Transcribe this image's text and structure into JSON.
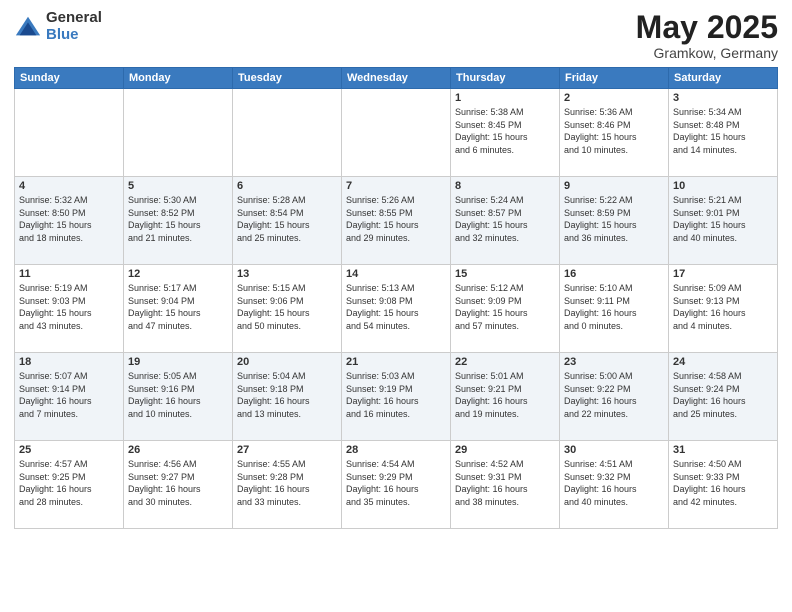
{
  "header": {
    "logo_general": "General",
    "logo_blue": "Blue",
    "month_year": "May 2025",
    "location": "Gramkow, Germany"
  },
  "weekdays": [
    "Sunday",
    "Monday",
    "Tuesday",
    "Wednesday",
    "Thursday",
    "Friday",
    "Saturday"
  ],
  "rows": [
    [
      {
        "day": "",
        "info": ""
      },
      {
        "day": "",
        "info": ""
      },
      {
        "day": "",
        "info": ""
      },
      {
        "day": "",
        "info": ""
      },
      {
        "day": "1",
        "info": "Sunrise: 5:38 AM\nSunset: 8:45 PM\nDaylight: 15 hours\nand 6 minutes."
      },
      {
        "day": "2",
        "info": "Sunrise: 5:36 AM\nSunset: 8:46 PM\nDaylight: 15 hours\nand 10 minutes."
      },
      {
        "day": "3",
        "info": "Sunrise: 5:34 AM\nSunset: 8:48 PM\nDaylight: 15 hours\nand 14 minutes."
      }
    ],
    [
      {
        "day": "4",
        "info": "Sunrise: 5:32 AM\nSunset: 8:50 PM\nDaylight: 15 hours\nand 18 minutes."
      },
      {
        "day": "5",
        "info": "Sunrise: 5:30 AM\nSunset: 8:52 PM\nDaylight: 15 hours\nand 21 minutes."
      },
      {
        "day": "6",
        "info": "Sunrise: 5:28 AM\nSunset: 8:54 PM\nDaylight: 15 hours\nand 25 minutes."
      },
      {
        "day": "7",
        "info": "Sunrise: 5:26 AM\nSunset: 8:55 PM\nDaylight: 15 hours\nand 29 minutes."
      },
      {
        "day": "8",
        "info": "Sunrise: 5:24 AM\nSunset: 8:57 PM\nDaylight: 15 hours\nand 32 minutes."
      },
      {
        "day": "9",
        "info": "Sunrise: 5:22 AM\nSunset: 8:59 PM\nDaylight: 15 hours\nand 36 minutes."
      },
      {
        "day": "10",
        "info": "Sunrise: 5:21 AM\nSunset: 9:01 PM\nDaylight: 15 hours\nand 40 minutes."
      }
    ],
    [
      {
        "day": "11",
        "info": "Sunrise: 5:19 AM\nSunset: 9:03 PM\nDaylight: 15 hours\nand 43 minutes."
      },
      {
        "day": "12",
        "info": "Sunrise: 5:17 AM\nSunset: 9:04 PM\nDaylight: 15 hours\nand 47 minutes."
      },
      {
        "day": "13",
        "info": "Sunrise: 5:15 AM\nSunset: 9:06 PM\nDaylight: 15 hours\nand 50 minutes."
      },
      {
        "day": "14",
        "info": "Sunrise: 5:13 AM\nSunset: 9:08 PM\nDaylight: 15 hours\nand 54 minutes."
      },
      {
        "day": "15",
        "info": "Sunrise: 5:12 AM\nSunset: 9:09 PM\nDaylight: 15 hours\nand 57 minutes."
      },
      {
        "day": "16",
        "info": "Sunrise: 5:10 AM\nSunset: 9:11 PM\nDaylight: 16 hours\nand 0 minutes."
      },
      {
        "day": "17",
        "info": "Sunrise: 5:09 AM\nSunset: 9:13 PM\nDaylight: 16 hours\nand 4 minutes."
      }
    ],
    [
      {
        "day": "18",
        "info": "Sunrise: 5:07 AM\nSunset: 9:14 PM\nDaylight: 16 hours\nand 7 minutes."
      },
      {
        "day": "19",
        "info": "Sunrise: 5:05 AM\nSunset: 9:16 PM\nDaylight: 16 hours\nand 10 minutes."
      },
      {
        "day": "20",
        "info": "Sunrise: 5:04 AM\nSunset: 9:18 PM\nDaylight: 16 hours\nand 13 minutes."
      },
      {
        "day": "21",
        "info": "Sunrise: 5:03 AM\nSunset: 9:19 PM\nDaylight: 16 hours\nand 16 minutes."
      },
      {
        "day": "22",
        "info": "Sunrise: 5:01 AM\nSunset: 9:21 PM\nDaylight: 16 hours\nand 19 minutes."
      },
      {
        "day": "23",
        "info": "Sunrise: 5:00 AM\nSunset: 9:22 PM\nDaylight: 16 hours\nand 22 minutes."
      },
      {
        "day": "24",
        "info": "Sunrise: 4:58 AM\nSunset: 9:24 PM\nDaylight: 16 hours\nand 25 minutes."
      }
    ],
    [
      {
        "day": "25",
        "info": "Sunrise: 4:57 AM\nSunset: 9:25 PM\nDaylight: 16 hours\nand 28 minutes."
      },
      {
        "day": "26",
        "info": "Sunrise: 4:56 AM\nSunset: 9:27 PM\nDaylight: 16 hours\nand 30 minutes."
      },
      {
        "day": "27",
        "info": "Sunrise: 4:55 AM\nSunset: 9:28 PM\nDaylight: 16 hours\nand 33 minutes."
      },
      {
        "day": "28",
        "info": "Sunrise: 4:54 AM\nSunset: 9:29 PM\nDaylight: 16 hours\nand 35 minutes."
      },
      {
        "day": "29",
        "info": "Sunrise: 4:52 AM\nSunset: 9:31 PM\nDaylight: 16 hours\nand 38 minutes."
      },
      {
        "day": "30",
        "info": "Sunrise: 4:51 AM\nSunset: 9:32 PM\nDaylight: 16 hours\nand 40 minutes."
      },
      {
        "day": "31",
        "info": "Sunrise: 4:50 AM\nSunset: 9:33 PM\nDaylight: 16 hours\nand 42 minutes."
      }
    ]
  ]
}
